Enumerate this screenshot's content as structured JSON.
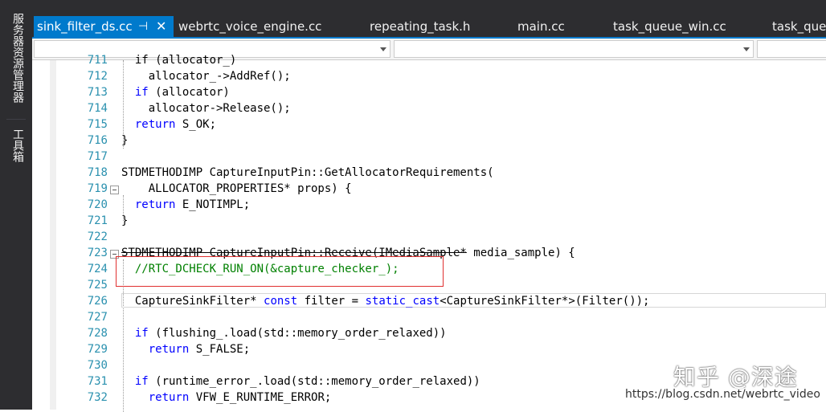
{
  "side_panels": [
    {
      "label": "服务器资源管理器"
    },
    {
      "label": "工具箱"
    }
  ],
  "tabs": [
    {
      "label": "sink_filter_ds.cc",
      "active": true
    },
    {
      "label": "webrtc_voice_engine.cc"
    },
    {
      "label": "repeating_task.h"
    },
    {
      "label": "main.cc"
    },
    {
      "label": "task_queue_win.cc"
    },
    {
      "label": "task_queu"
    }
  ],
  "tab_icons": {
    "pin": "pin-icon",
    "close": "close-icon"
  },
  "colors": {
    "accent": "#007acc",
    "keyword": "#0000ff",
    "comment": "#008000",
    "type": "#2b91af",
    "line_number": "#2b91af",
    "highlight_box": "#e03030"
  },
  "editor": {
    "lines": [
      {
        "n": "711",
        "segs": [
          {
            "t": "  if (allocator_)"
          }
        ]
      },
      {
        "n": "712",
        "segs": [
          {
            "t": "    allocator_->AddRef();"
          }
        ]
      },
      {
        "n": "713",
        "segs": [
          {
            "t": "  "
          },
          {
            "t": "if",
            "c": "kw"
          },
          {
            "t": " (allocator)"
          }
        ]
      },
      {
        "n": "714",
        "segs": [
          {
            "t": "    allocator->Release();"
          }
        ]
      },
      {
        "n": "715",
        "segs": [
          {
            "t": "  "
          },
          {
            "t": "return",
            "c": "kw"
          },
          {
            "t": " S_OK;"
          }
        ]
      },
      {
        "n": "716",
        "segs": [
          {
            "t": "}"
          }
        ]
      },
      {
        "n": "717",
        "segs": [
          {
            "t": ""
          }
        ]
      },
      {
        "n": "718",
        "segs": [
          {
            "t": "STDMETHODIMP CaptureInputPin::GetAllocatorRequirements("
          }
        ]
      },
      {
        "n": "719",
        "segs": [
          {
            "t": "    ALLOCATOR_PROPERTIES* props) {"
          }
        ]
      },
      {
        "n": "720",
        "segs": [
          {
            "t": "  "
          },
          {
            "t": "return",
            "c": "kw"
          },
          {
            "t": " E_NOTIMPL;"
          }
        ]
      },
      {
        "n": "721",
        "segs": [
          {
            "t": "}"
          }
        ]
      },
      {
        "n": "722",
        "segs": [
          {
            "t": ""
          }
        ]
      },
      {
        "n": "723",
        "segs": [
          {
            "t": "STDMETHODIMP CaptureInputPin::Receive(IMediaSample*",
            "c": "strike"
          },
          {
            "t": " media_sample) {"
          }
        ]
      },
      {
        "n": "724",
        "segs": [
          {
            "t": "  "
          },
          {
            "t": "//RTC_DCHECK_RUN_ON(&capture_checker_);",
            "c": "cm"
          }
        ]
      },
      {
        "n": "725",
        "segs": [
          {
            "t": ""
          }
        ]
      },
      {
        "n": "726",
        "segs": [
          {
            "t": "  CaptureSinkFilter* "
          },
          {
            "t": "const",
            "c": "kw"
          },
          {
            "t": " filter = "
          },
          {
            "t": "static_cast",
            "c": "kw"
          },
          {
            "t": "<CaptureSinkFilter*>(Filter());"
          }
        ]
      },
      {
        "n": "727",
        "segs": [
          {
            "t": ""
          }
        ]
      },
      {
        "n": "728",
        "segs": [
          {
            "t": "  "
          },
          {
            "t": "if",
            "c": "kw"
          },
          {
            "t": " (flushing_.load(std::memory_order_relaxed))"
          }
        ]
      },
      {
        "n": "729",
        "segs": [
          {
            "t": "    "
          },
          {
            "t": "return",
            "c": "kw"
          },
          {
            "t": " S_FALSE;"
          }
        ]
      },
      {
        "n": "730",
        "segs": [
          {
            "t": ""
          }
        ]
      },
      {
        "n": "731",
        "segs": [
          {
            "t": "  "
          },
          {
            "t": "if",
            "c": "kw"
          },
          {
            "t": " (runtime_error_.load(std::memory_order_relaxed))"
          }
        ]
      },
      {
        "n": "732",
        "segs": [
          {
            "t": "    "
          },
          {
            "t": "return",
            "c": "kw"
          },
          {
            "t": " VFW_E_RUNTIME_ERROR;"
          }
        ]
      }
    ]
  },
  "watermark": {
    "brand": "知乎 @深途",
    "url": "https://blog.csdn.net/webrtc_video"
  }
}
